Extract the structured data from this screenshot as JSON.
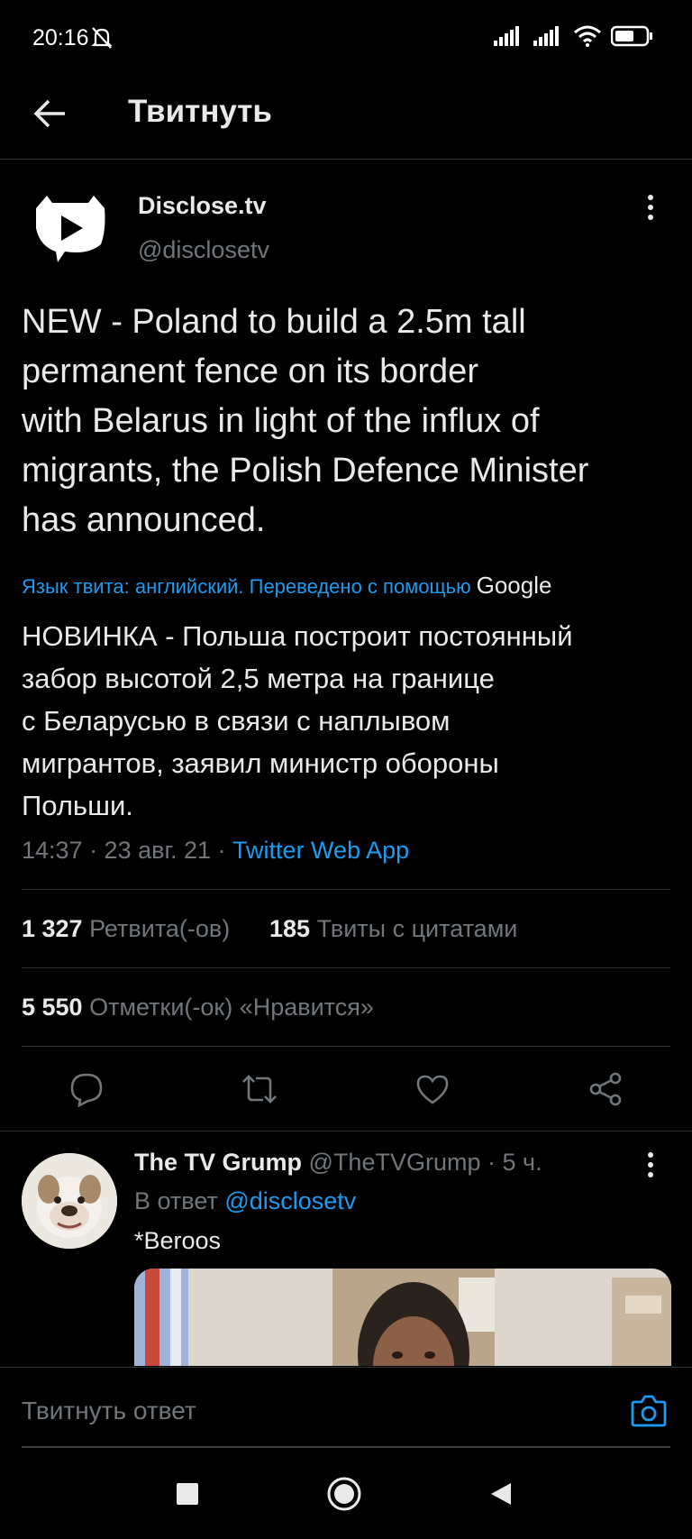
{
  "status_bar": {
    "time": "20:16"
  },
  "header": {
    "title": "Твитнуть"
  },
  "tweet": {
    "author_name": "Disclose.tv",
    "author_handle": "@disclosetv",
    "text_lines": [
      "NEW - Poland to build a 2.5m tall",
      "permanent fence on its border",
      "with Belarus in light of the influx of",
      "migrants, the Polish Defence Minister",
      "has announced."
    ],
    "translate_note": "Язык твита: английский. Переведено с помощью",
    "translate_provider": "Google",
    "translation_lines": [
      "НОВИНКА - Польша построит постоянный",
      "забор высотой 2,5 метра на границе",
      "с Беларусью в связи с наплывом",
      "мигрантов, заявил министр обороны",
      "Польши."
    ],
    "timestamp": "14:37 · 23 авг. 21 · ",
    "source": "Twitter Web App",
    "retweets_count": "1 327",
    "retweets_label": "Ретвита(-ов)",
    "quotes_count": "185",
    "quotes_label": "Твиты с цитатами",
    "likes_count": "5 550",
    "likes_label": "Отметки(-ок) «Нравится»"
  },
  "actions": [
    {
      "name": "reply-icon"
    },
    {
      "name": "retweet-icon"
    },
    {
      "name": "like-icon"
    },
    {
      "name": "share-icon"
    }
  ],
  "reply": {
    "author_name": "The TV Grump",
    "author_handle": "@TheTVGrump",
    "time": "· 5 ч.",
    "in_reply_prefix": "В ответ ",
    "in_reply_to": "@disclosetv",
    "text": "*Beroos"
  },
  "compose": {
    "placeholder": "Твитнуть ответ"
  },
  "colors": {
    "accent": "#1d9bf0",
    "background": "#000000",
    "muted": "#71767b",
    "text": "#e7e9ea"
  }
}
